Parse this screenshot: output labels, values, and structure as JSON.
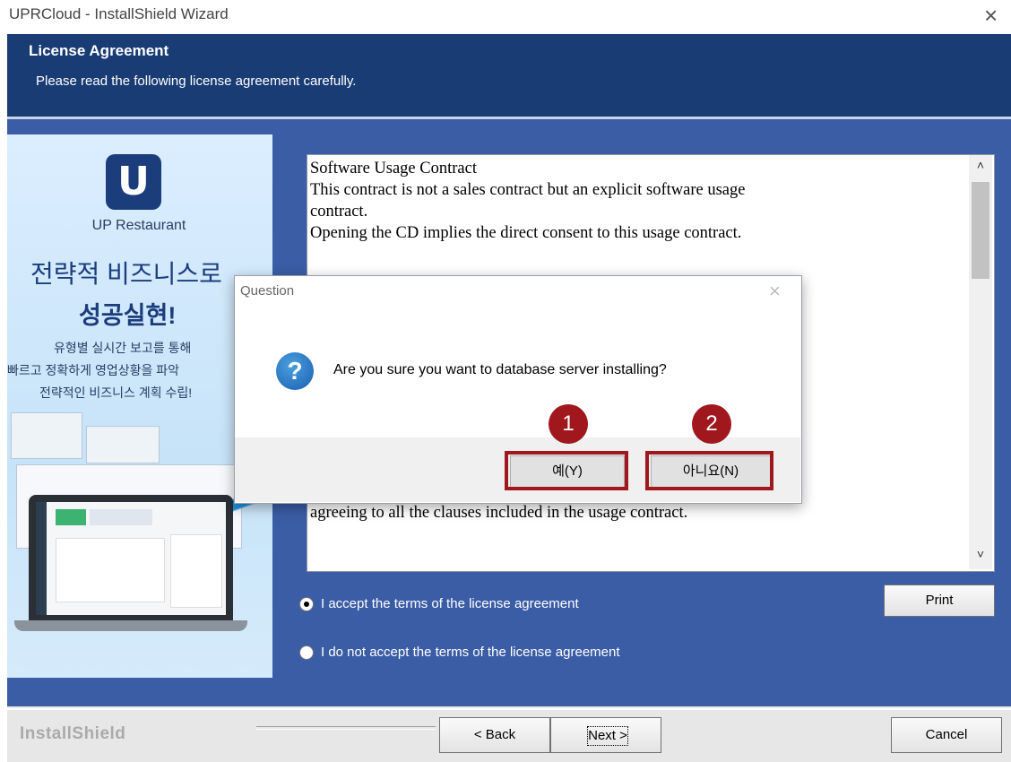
{
  "window": {
    "title": "UPRCloud - InstallShield Wizard",
    "close_glyph": "×"
  },
  "header": {
    "title": "License Agreement",
    "subtitle": "Please read the following license agreement carefully."
  },
  "banner": {
    "logo_letter": "U",
    "brand": "UP Restaurant",
    "slogan_line1": "전략적 비즈니스로",
    "slogan_line2": "성공실현!",
    "desc_line1": "유형별 실시간 보고를 통해",
    "desc_line2": "빠르고 정확하게 영업상황을 파악",
    "desc_line3": "전략적인 비즈니스 계획 수립!"
  },
  "license": {
    "text": "Software Usage Contract\nThis contract is not a sales contract but an explicit software usage\ncontract.\nOpening the CD implies the direct consent to this usage contract.\n\n\n\n                                                                  full access.\n                                                                  access of this\n                                                                  pying due to\n\n\n\n\n\nYou are granted the usage license under the circumstances of\nagreeing to all the clauses included in the usage contract."
  },
  "scrollbar": {
    "up_glyph": "˄",
    "down_glyph": "˅"
  },
  "options": {
    "accept_label": "I accept the terms of the license agreement",
    "decline_label": "I do not accept the terms of the license agreement",
    "selected": "accept"
  },
  "buttons": {
    "print": "Print",
    "back": "< Back",
    "next": "Next >",
    "cancel": "Cancel"
  },
  "footer": {
    "brand": "InstallShield"
  },
  "dialog": {
    "title": "Question",
    "close_glyph": "×",
    "icon_glyph": "?",
    "message": "Are you sure you want to database server installing?",
    "yes_label": "예(Y)",
    "no_label": "아니요(N)"
  },
  "annotations": {
    "marker1": "1",
    "marker2": "2",
    "highlight_color": "#a0181e"
  },
  "colors": {
    "header_bg": "#1a3c74",
    "body_bg": "#3b5da6"
  }
}
